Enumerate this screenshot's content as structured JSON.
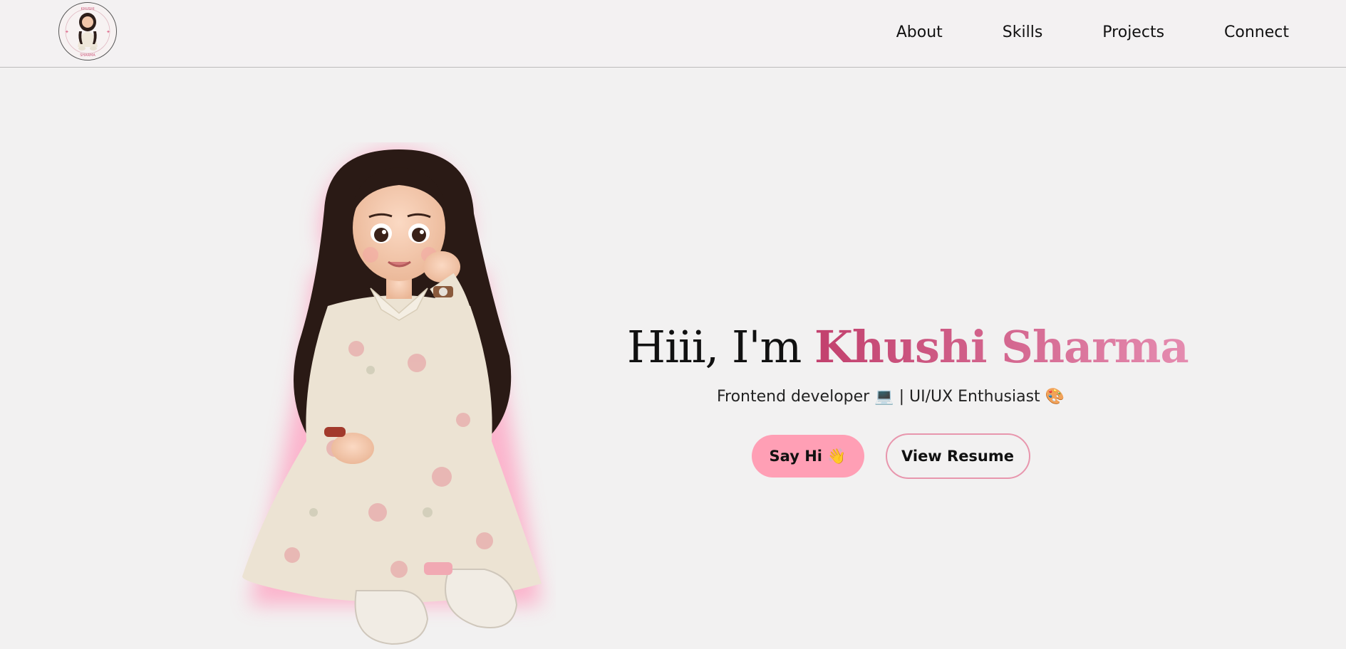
{
  "nav": {
    "logo": {
      "alt": "logo",
      "top_text": "KHUSHI",
      "bottom_text": "SHARMA"
    },
    "links": [
      {
        "label": "About"
      },
      {
        "label": "Skills"
      },
      {
        "label": "Projects"
      },
      {
        "label": "Connect"
      }
    ]
  },
  "hero": {
    "greeting": "Hiii, I'm ",
    "name": "Khushi Sharma",
    "subtitle": "Frontend developer 💻 | UI/UX Enthusiast 🎨",
    "buttons": {
      "primary": "Say Hi 👋",
      "secondary": "View Resume"
    }
  },
  "colors": {
    "accent_pink": "#ff9fb5",
    "name_gradient_start": "#c2406d",
    "name_gradient_end": "#e58cb0",
    "background": "#f2f1f1"
  }
}
